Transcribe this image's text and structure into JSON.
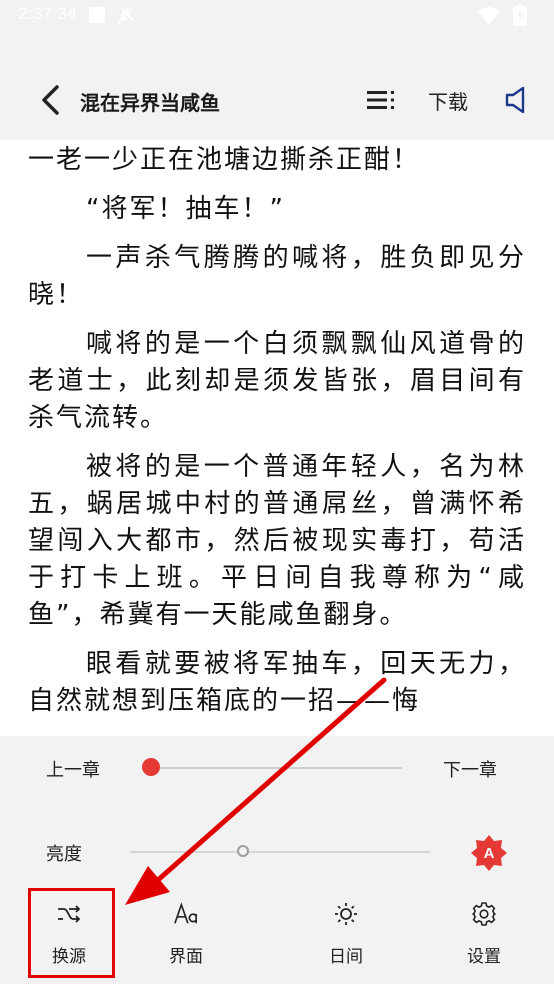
{
  "status_bar": {
    "time": "2:37:34"
  },
  "app_bar": {
    "title": "混在异界当咸鱼",
    "download_label": "下载"
  },
  "content": {
    "paragraphs": [
      "一老一少正在池塘边撕杀正酣！",
      "“将军！抽车！”",
      "一声杀气腾腾的喊将，胜负即见分晓！",
      "喊将的是一个白须飘飘仙风道骨的老道士，此刻却是须发皆张，眉目间有杀气流转。",
      "被将的是一个普通年轻人，名为林五，蜗居城中村的普通屌丝，曾满怀希望闯入大都市，然后被现实毒打，苟活于打卡上班。平日间自我尊称为“咸鱼”，希冀有一天能咸鱼翻身。",
      "眼看就要被将军抽车，回天无力，自然就想到压箱底的一招——悔"
    ]
  },
  "reader_panel": {
    "prev_chapter": "上一章",
    "next_chapter": "下一章",
    "chapter_progress": 0.0,
    "brightness_label": "亮度",
    "brightness_level": 0.38,
    "auto_brightness_letter": "A"
  },
  "toolbar": {
    "items": [
      {
        "label": "换源",
        "icon": "shuffle-icon"
      },
      {
        "label": "界面",
        "icon": "font-size-icon"
      },
      {
        "label": "日间",
        "icon": "sun-icon"
      },
      {
        "label": "设置",
        "icon": "gear-icon"
      }
    ]
  },
  "colors": {
    "accent": "#e53935",
    "highlight": "#e00000",
    "panel_bg": "#f2f2f2"
  }
}
